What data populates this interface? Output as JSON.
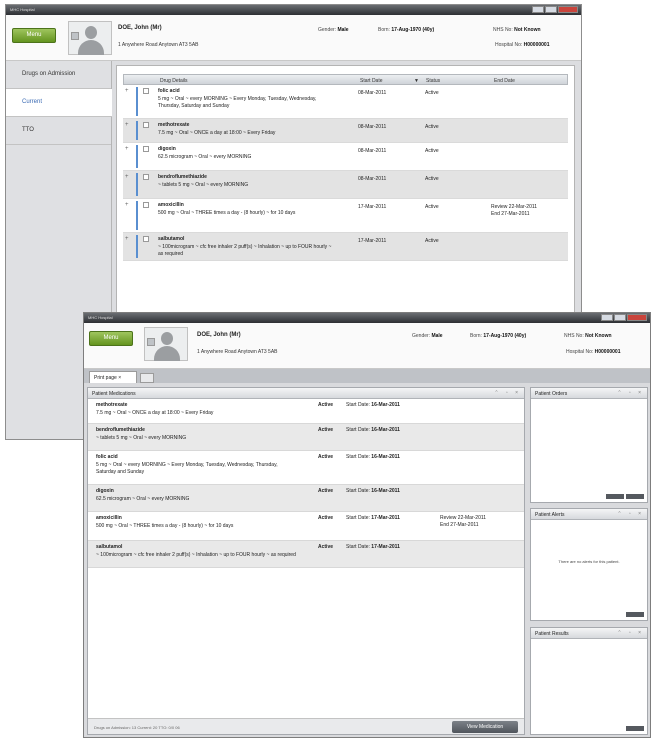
{
  "patient": {
    "name": "DOE, John (Mr)",
    "address": "1 Anywhere Road Anytown AT3 5AB",
    "gender_label": "Gender:",
    "gender": "Male",
    "born_label": "Born:",
    "born": "17-Aug-1970 (40y)",
    "nhs_label": "NHS No:",
    "nhs": "Not Known",
    "hospital_label": "Hospital No:",
    "hospital": "H00000001"
  },
  "window1": {
    "title": "MHC Hospital",
    "menu_label": "Menu",
    "nav": [
      "Drugs on Admission",
      "Current",
      "TTO"
    ],
    "columns": [
      "Drug Details",
      "Start Date",
      "Status",
      "End Date"
    ],
    "rows": [
      {
        "name": "folic acid",
        "detail": "5 mg ~ Oral ~ every MORNING ~ Every Monday, Tuesday, Wednesday, Thursday, Saturday and Sunday",
        "start": "08-Mar-2011",
        "status": "Active",
        "review": ""
      },
      {
        "name": "methotrexate",
        "detail": "7.5 mg ~ Oral ~ ONCE a day at 18:00 ~ Every Friday",
        "start": "08-Mar-2011",
        "status": "Active",
        "review": ""
      },
      {
        "name": "digoxin",
        "detail": "62.5 microgram ~ Oral ~ every MORNING",
        "start": "08-Mar-2011",
        "status": "Active",
        "review": ""
      },
      {
        "name": "bendroflumethiazide",
        "detail": "~ tablets 5 mg ~ Oral ~ every MORNING",
        "start": "08-Mar-2011",
        "status": "Active",
        "review": ""
      },
      {
        "name": "amoxicillin",
        "detail": "500 mg ~ Oral ~ THREE times a day - (8 hourly) ~ for 10 days",
        "start": "17-Mar-2011",
        "status": "Active",
        "review": "Review 22-Mar-2011\nEnd 27-Mar-2011"
      },
      {
        "name": "salbutamol",
        "detail": "~ 100microgram ~ cfc free inhaler 2 puff(s) ~ Inhalation ~ up to FOUR hourly ~ as required",
        "start": "17-Mar-2011",
        "status": "Active",
        "review": ""
      }
    ]
  },
  "window2": {
    "title": "MHC Hospital",
    "menu_label": "Menu",
    "tab_label": "Print page",
    "meds_title": "Patient Medications",
    "start_label": "Start Date:",
    "meds": [
      {
        "name": "methotrexate",
        "detail": "7.5 mg ~ Oral ~ ONCE a day at 18:00 ~ Every Friday",
        "status": "Active",
        "start": "16-Mar-2011",
        "review": ""
      },
      {
        "name": "bendroflumethiazide",
        "detail": "~ tablets 5 mg ~ Oral ~ every MORNING",
        "status": "Active",
        "start": "16-Mar-2011",
        "review": ""
      },
      {
        "name": "folic acid",
        "detail": "5 mg ~ Oral ~ every MORNING ~ Every Monday, Tuesday, Wednesday, Thursday, Saturday and Sunday",
        "status": "Active",
        "start": "16-Mar-2011",
        "review": ""
      },
      {
        "name": "digoxin",
        "detail": "62.5 microgram ~ Oral ~ every MORNING",
        "status": "Active",
        "start": "16-Mar-2011",
        "review": ""
      },
      {
        "name": "amoxicillin",
        "detail": "500 mg ~ Oral ~ THREE times a day - (8 hourly) ~ for 10 days",
        "status": "Active",
        "start": "17-Mar-2011",
        "review": "Review 22-Mar-2011\nEnd 27-Mar-2011"
      },
      {
        "name": "salbutamol",
        "detail": "~ 100microgram ~ cfc free inhaler 2 puff(s) ~ Inhalation ~ up to FOUR hourly ~ as required",
        "status": "Active",
        "start": "17-Mar-2011",
        "review": ""
      }
    ],
    "footer_text": "Drugs on Admission: 13 Current: 20 TTO: 0/0 06",
    "footer_button": "View Medication",
    "side_panels": [
      {
        "title": "Patient Orders"
      },
      {
        "title": "Patient Alerts",
        "message": "There are no alerts for this patient."
      },
      {
        "title": "Patient Results"
      }
    ]
  }
}
